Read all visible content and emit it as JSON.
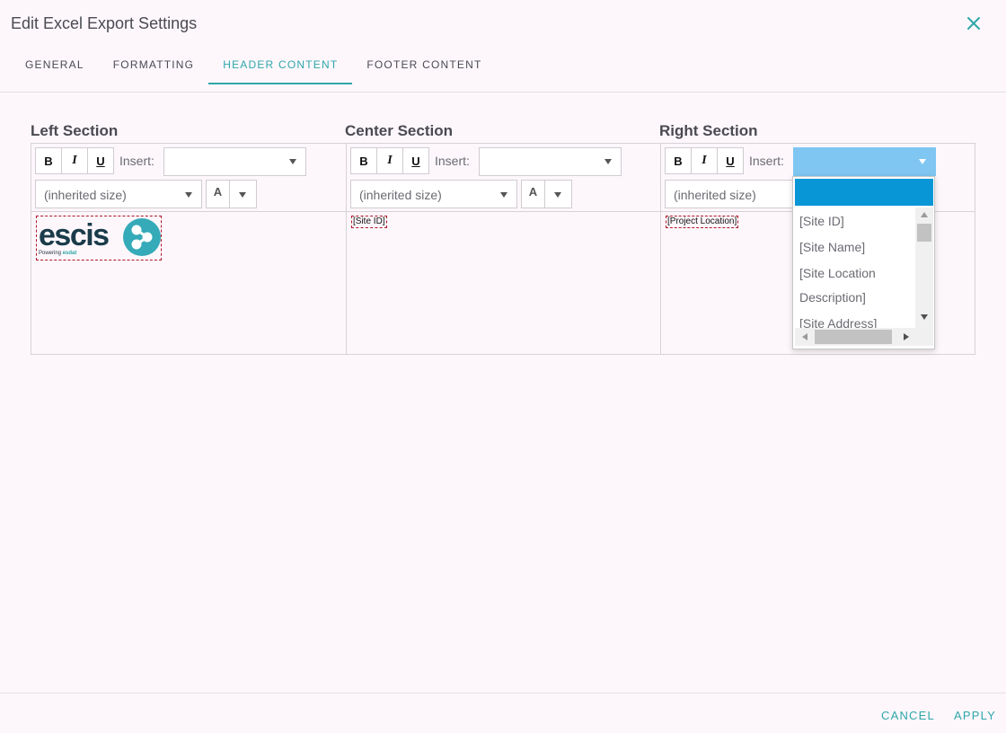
{
  "dialog": {
    "title": "Edit Excel Export Settings"
  },
  "icons": {
    "close": "close-icon"
  },
  "colors": {
    "accent": "#2ea7a8",
    "dropdown_highlight": "#0896d6",
    "open_select": "#7fc6f2",
    "placeholder_border": "#b1172a"
  },
  "tabs": [
    {
      "label": "GENERAL",
      "active": false
    },
    {
      "label": "FORMATTING",
      "active": false
    },
    {
      "label": "HEADER CONTENT",
      "active": true
    },
    {
      "label": "FOOTER CONTENT",
      "active": false
    }
  ],
  "sections": {
    "left": {
      "title": "Left Section",
      "toolbar": {
        "bold": "B",
        "italic": "I",
        "underline": "U",
        "insert_label": "Insert:",
        "insert_value": "",
        "size_value": "(inherited size)",
        "color_letter": "A"
      },
      "content": {
        "logo": {
          "text": "escis",
          "sub_prefix": "Powering ",
          "sub_brand": "esdat"
        }
      }
    },
    "center": {
      "title": "Center Section",
      "toolbar": {
        "bold": "B",
        "italic": "I",
        "underline": "U",
        "insert_label": "Insert:",
        "insert_value": "",
        "size_value": "(inherited size)",
        "color_letter": "A"
      },
      "content": {
        "placeholder": "[Site ID]"
      }
    },
    "right": {
      "title": "Right Section",
      "toolbar": {
        "bold": "B",
        "italic": "I",
        "underline": "U",
        "insert_label": "Insert:",
        "insert_value": "",
        "size_value": "(inherited size)"
      },
      "content": {
        "placeholder": "[Project Location]"
      },
      "insert_dropdown": {
        "open": true,
        "options": [
          "[Site ID]",
          "[Site Name]",
          "[Site Location",
          "Description]",
          "[Site Address]"
        ]
      }
    }
  },
  "footer": {
    "cancel_label": "CANCEL",
    "apply_label": "APPLY"
  }
}
